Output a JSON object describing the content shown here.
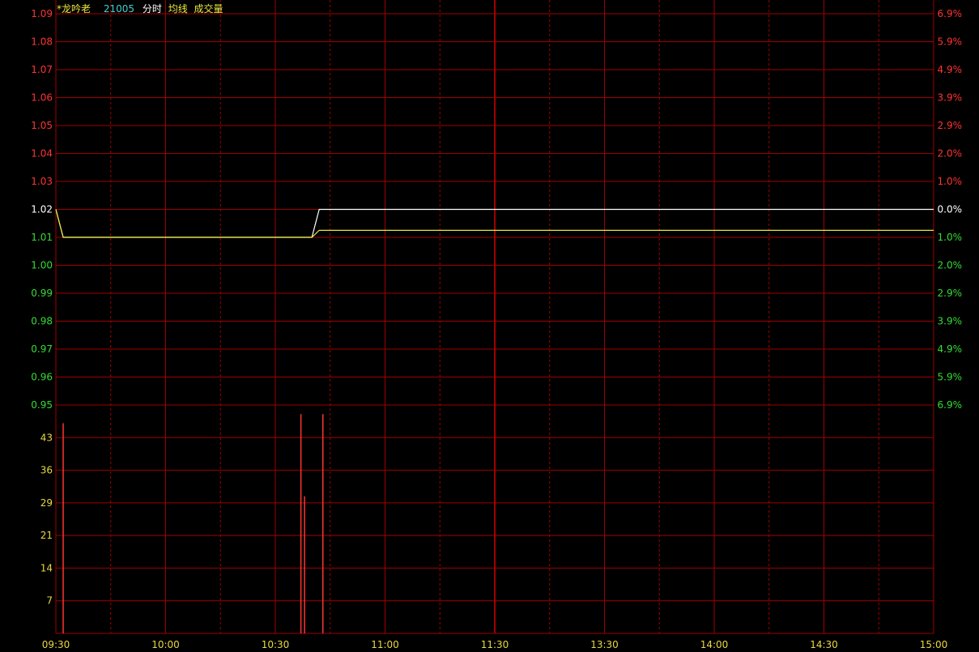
{
  "header": {
    "name": "*龙吟老",
    "code": "21005",
    "legend": [
      "分时",
      "均线",
      "成交量"
    ]
  },
  "colors": {
    "background": "#000000",
    "grid": "#a00000",
    "up": "#ff3333",
    "down": "#33dd33",
    "flat": "#ffffff",
    "volume_axis": "#e8d840",
    "avg_line": "#e8e840",
    "price_line": "#ffffff",
    "time_axis": "#e8d840",
    "name": "#e8e840",
    "code": "#40d0d0"
  },
  "chart_data": {
    "type": "line",
    "price_panel": {
      "prev_close": 1.02,
      "ylim": [
        0.95,
        1.09
      ],
      "price_ticks": [
        "1.09",
        "1.08",
        "1.07",
        "1.06",
        "1.05",
        "1.04",
        "1.03",
        "1.02",
        "1.01",
        "1.00",
        "0.99",
        "0.98",
        "0.97",
        "0.96",
        "0.95"
      ],
      "pct_ticks": [
        "6.9%",
        "5.9%",
        "4.9%",
        "3.9%",
        "2.9%",
        "2.0%",
        "1.0%",
        "0.0%",
        "1.0%",
        "2.0%",
        "2.9%",
        "3.9%",
        "4.9%",
        "5.9%",
        "6.9%"
      ],
      "series": [
        {
          "name": "分时",
          "x_minutes": [
            0,
            2,
            70,
            72,
            240
          ],
          "values": [
            1.02,
            1.01,
            1.01,
            1.02,
            1.02
          ]
        },
        {
          "name": "均线",
          "x_minutes": [
            0,
            2,
            70,
            72,
            240
          ],
          "values": [
            1.02,
            1.01,
            1.01,
            1.0125,
            1.0125
          ]
        }
      ]
    },
    "volume_panel": {
      "ylim": [
        0,
        50
      ],
      "ticks": [
        "43",
        "36",
        "29",
        "21",
        "14",
        "7"
      ],
      "bars": [
        {
          "minute": 2,
          "value": 46
        },
        {
          "minute": 67,
          "value": 48
        },
        {
          "minute": 68,
          "value": 30
        },
        {
          "minute": 73,
          "value": 48
        }
      ]
    },
    "x_labels": [
      "09:30",
      "10:00",
      "10:30",
      "11:00",
      "11:30",
      "13:30",
      "14:00",
      "14:30",
      "15:00"
    ]
  }
}
